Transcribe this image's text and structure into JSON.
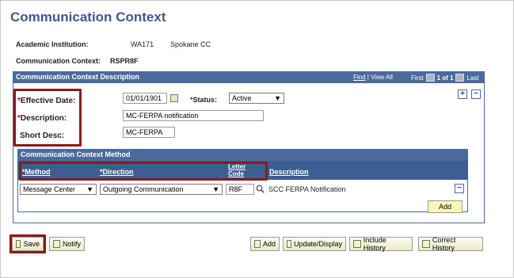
{
  "page_title": "Communication Context",
  "institution": {
    "label": "Academic Institution:",
    "code": "WA171",
    "name": "Spokane CC"
  },
  "context": {
    "label": "Communication Context:",
    "value": "RSPR8F"
  },
  "section": {
    "title": "Communication Context Description",
    "find": "Find",
    "view_all": "View All",
    "first": "First",
    "range": "1 of 1",
    "last": "Last"
  },
  "form": {
    "effective_date_label": "Effective Date:",
    "effective_date": "01/01/1901",
    "status_label": "Status:",
    "status": "Active",
    "description_label": "Description:",
    "description": "MC-FERPA notification",
    "short_desc_label": "Short Desc:",
    "short_desc": "MC-FERPA",
    "required_mark": "*"
  },
  "method_section": {
    "title": "Communication Context Method",
    "columns": {
      "method": "*Method",
      "direction": "*Direction",
      "letter_code_1": "Letter",
      "letter_code_2": "Code",
      "description": "Description"
    },
    "row": {
      "method": "Message Center",
      "direction": "Outgoing Communication",
      "letter_code": "R8F",
      "description": "SCC FERPA Notification"
    },
    "add_label": "Add"
  },
  "toolbar": {
    "save": "Save",
    "notify": "Notify",
    "add": "Add",
    "update_display": "Update/Display",
    "include_history": "Include History",
    "correct_history": "Correct History"
  },
  "icons": {
    "plus": "+",
    "minus": "−",
    "dropdown": "▼",
    "lookup": "magnifier-icon",
    "calendar": "calendar-icon"
  },
  "colors": {
    "header_blue": "#4b6a9c",
    "title_blue": "#3c5a8c",
    "highlight_red": "#8b1a1a"
  }
}
